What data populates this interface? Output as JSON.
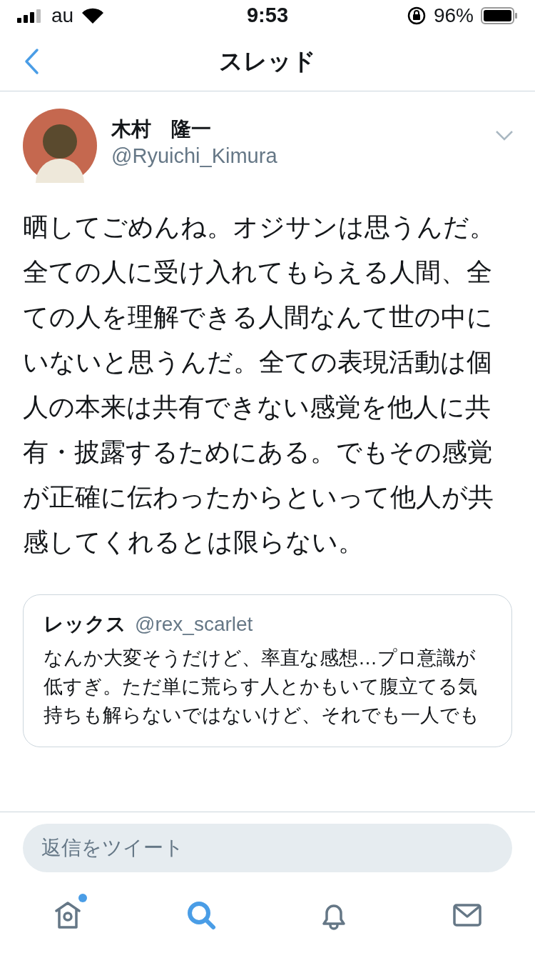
{
  "status_bar": {
    "carrier": "au",
    "time": "9:53",
    "battery": "96%"
  },
  "nav": {
    "title": "スレッド"
  },
  "tweet": {
    "name": "木村　隆一",
    "handle": "@Ryuichi_Kimura",
    "text": "晒してごめんね。オジサンは思うんだ。全ての人に受け入れてもらえる人間、全ての人を理解できる人間なんて世の中にいないと思うんだ。全ての表現活動は個人の本来は共有できない感覚を他人に共有・披露するためにある。でもその感覚が正確に伝わったからといって他人が共感してくれるとは限らない。",
    "quoted": {
      "name": "レックス",
      "handle": "@rex_scarlet",
      "text": "なんか大変そうだけど、率直な感想…プロ意識が低すぎ。ただ単に荒らす人とかもいて腹立てる気持ちも解らないではないけど、それでも一人でも"
    }
  },
  "reply": {
    "placeholder": "返信をツイート"
  },
  "tabs": [
    {
      "kind": "home",
      "selected": false,
      "notification_dot": true
    },
    {
      "kind": "search",
      "selected": true,
      "notification_dot": false
    },
    {
      "kind": "notifications",
      "selected": false,
      "notification_dot": false
    },
    {
      "kind": "messages",
      "selected": false,
      "notification_dot": false
    }
  ]
}
